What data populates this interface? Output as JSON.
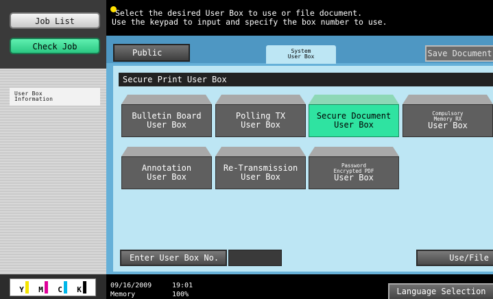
{
  "left_panel": {
    "job_list_label": "Job List",
    "check_job_label": "Check Job",
    "info_line1": "User Box",
    "info_line2": "Information"
  },
  "toner": [
    {
      "label": "Y",
      "color": "#f5e400"
    },
    {
      "label": "M",
      "color": "#e0009a"
    },
    {
      "label": "C",
      "color": "#00b7ea"
    },
    {
      "label": "K",
      "color": "#000000"
    }
  ],
  "header": {
    "message_line1": "Select the desired User Box to use or file document.",
    "message_line2": "Use the keypad to input and specify the box number to use."
  },
  "tabs": {
    "public": "Public",
    "system_line1": "System",
    "system_line2": "User Box",
    "save_document": "Save Document"
  },
  "section_title": "Secure Print User Box",
  "boxes": {
    "bulletin_board": {
      "line1": "Bulletin Board",
      "line2": "User Box"
    },
    "polling_tx": {
      "line1": "Polling TX",
      "line2": "User Box"
    },
    "secure_document": {
      "line1": "Secure Document",
      "line2": "User Box"
    },
    "compulsory_memory_rx": {
      "line1": "Compulsory",
      "line2": "Memory RX",
      "line3": "User Box"
    },
    "annotation": {
      "line1": "Annotation",
      "line2": "User Box"
    },
    "re_transmission": {
      "line1": "Re-Transmission",
      "line2": "User Box"
    },
    "password_pdf": {
      "line1": "Password",
      "line2": "Encrypted PDF",
      "line3": "User Box"
    }
  },
  "actions": {
    "enter_box_no": "Enter User Box No.",
    "use_file": "Use/File"
  },
  "footer": {
    "date": "09/16/2009",
    "time": "19:01",
    "memory_label": "Memory",
    "memory_value": "100%",
    "language_selection": "Language Selection"
  }
}
